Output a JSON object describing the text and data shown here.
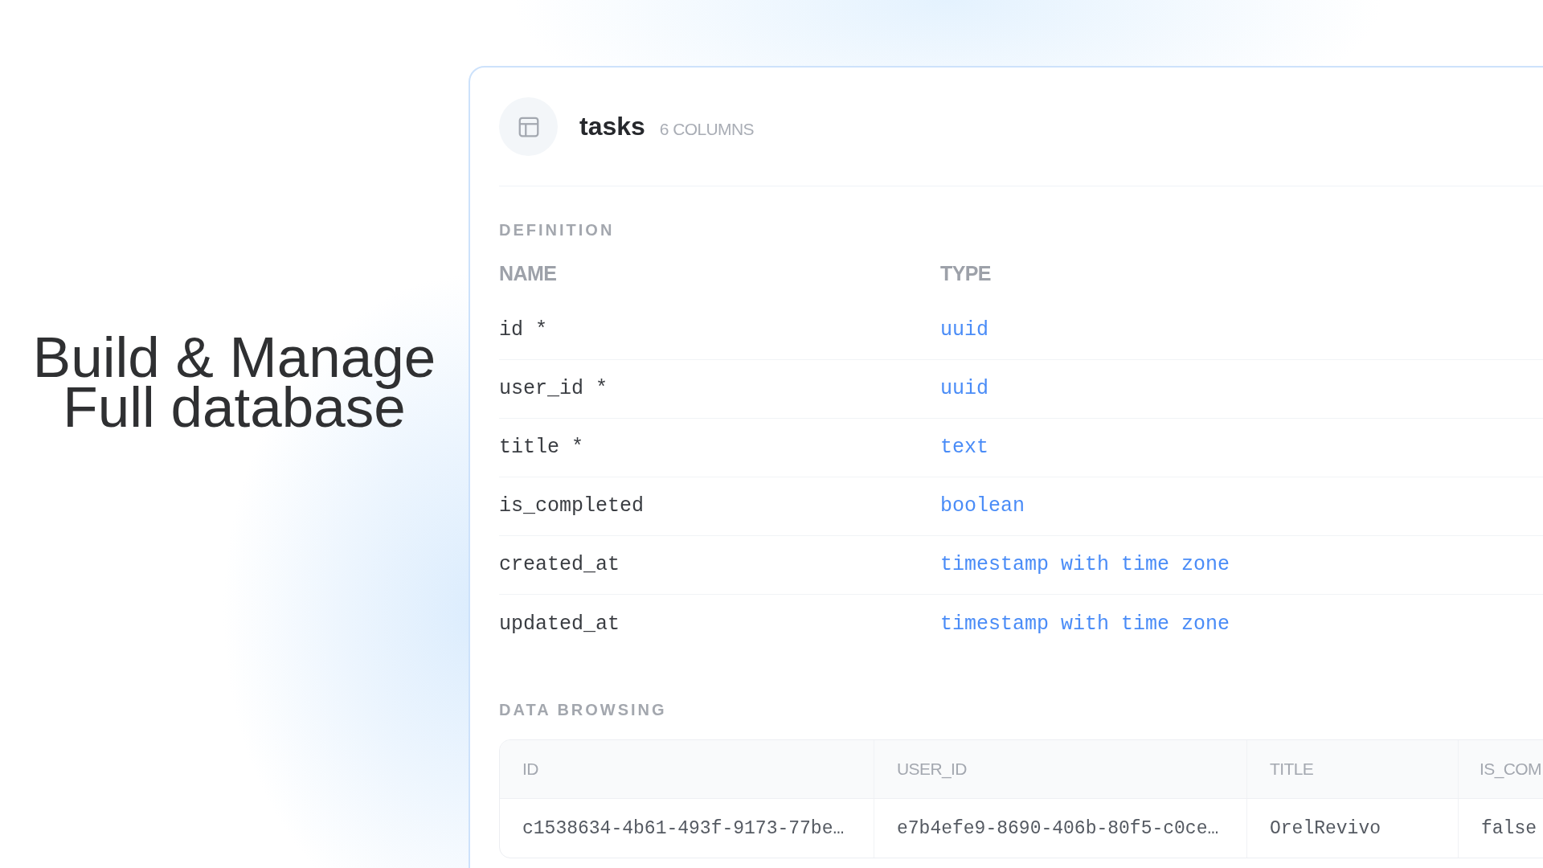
{
  "headline": {
    "lines": [
      "Build & Manage",
      "Full database"
    ]
  },
  "table_panel": {
    "header": {
      "name": "tasks",
      "column_count": "6 COLUMNS"
    },
    "definition": {
      "label": "DEFINITION",
      "columns": [
        "NAME",
        "TYPE"
      ],
      "fields": [
        {
          "name": "id *",
          "type": "uuid"
        },
        {
          "name": "user_id *",
          "type": "uuid"
        },
        {
          "name": "title *",
          "type": "text"
        },
        {
          "name": "is_completed",
          "type": "boolean"
        },
        {
          "name": "created_at",
          "type": "timestamp with time zone"
        },
        {
          "name": "updated_at",
          "type": "timestamp with time zone"
        }
      ]
    },
    "data_browsing": {
      "label": "DATA BROWSING",
      "columns": [
        "ID",
        "USER_ID",
        "TITLE",
        "IS_COM"
      ],
      "rows": [
        [
          "c1538634-4b61-493f-9173-77be…",
          "e7b4efe9-8690-406b-80f5-c0ce…",
          "OrelRevivo",
          "false"
        ]
      ]
    }
  }
}
